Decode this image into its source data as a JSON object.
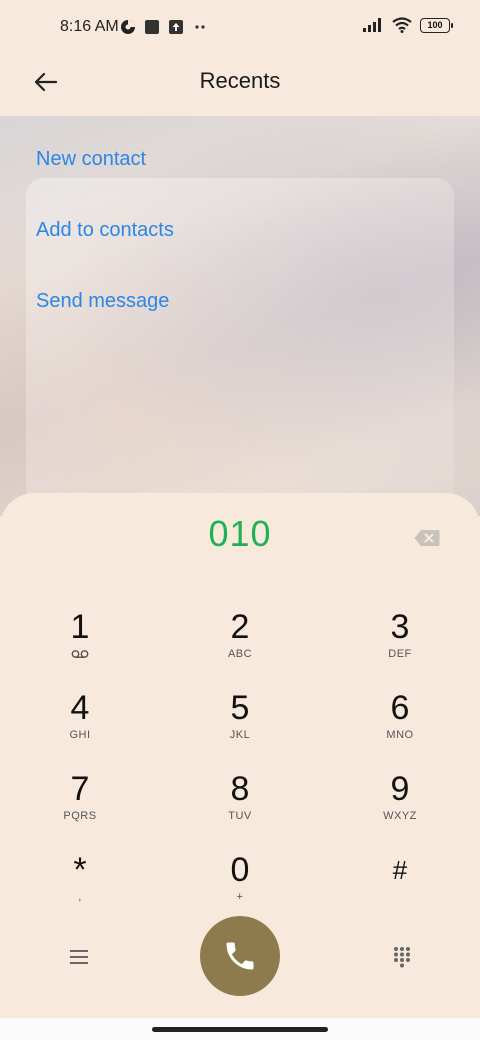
{
  "status_bar": {
    "time": "8:16 AM",
    "battery": "100",
    "icons": [
      "app-notification-icon",
      "square-notification-icon",
      "upload-notification-icon",
      "more-dots-icon",
      "signal-icon",
      "wifi-icon",
      "battery-icon"
    ]
  },
  "header": {
    "title": "Recents",
    "back_icon": "arrow-left-icon"
  },
  "actions": {
    "new_contact": "New contact",
    "add_to_contacts": "Add to contacts",
    "send_message": "Send message"
  },
  "dialer": {
    "number": "010",
    "backspace_icon": "backspace-icon",
    "accent_color": "#1fb255",
    "call_button_color": "#8d7b4d",
    "link_color": "#2b86e6",
    "keys": [
      {
        "digit": "1",
        "letters": ""
      },
      {
        "digit": "2",
        "letters": "ABC"
      },
      {
        "digit": "3",
        "letters": "DEF"
      },
      {
        "digit": "4",
        "letters": "GHI"
      },
      {
        "digit": "5",
        "letters": "JKL"
      },
      {
        "digit": "6",
        "letters": "MNO"
      },
      {
        "digit": "7",
        "letters": "PQRS"
      },
      {
        "digit": "8",
        "letters": "TUV"
      },
      {
        "digit": "9",
        "letters": "WXYZ"
      },
      {
        "digit": "*",
        "letters": ","
      },
      {
        "digit": "0",
        "letters": "+"
      },
      {
        "digit": "#",
        "letters": ""
      }
    ],
    "bottom_icons": [
      "menu-icon",
      "phone-icon",
      "dialpad-icon"
    ]
  }
}
